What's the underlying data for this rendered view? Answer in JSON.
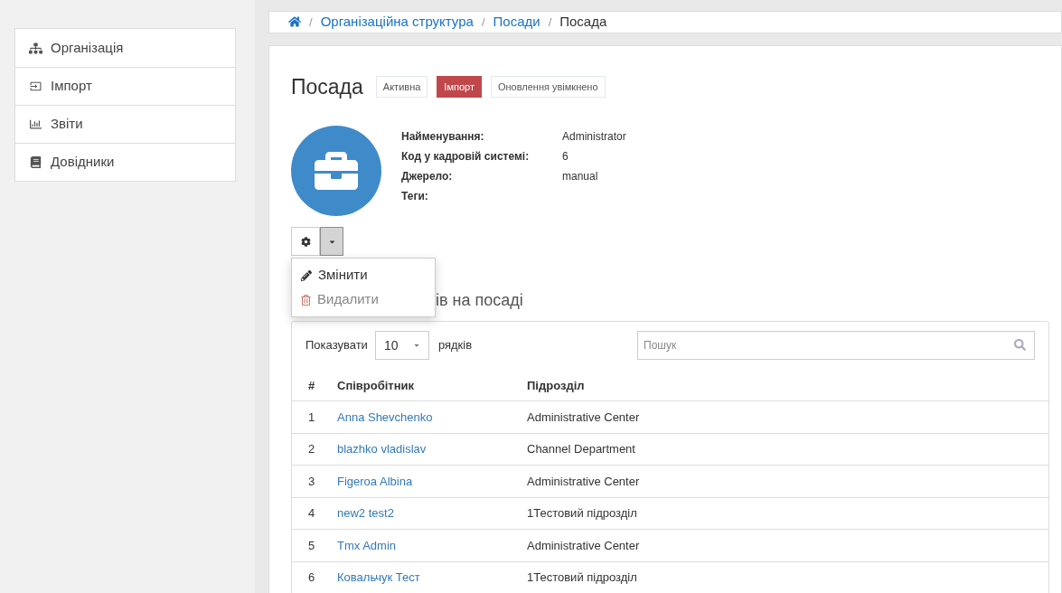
{
  "sidebar": {
    "items": [
      {
        "label": "Організація",
        "kind": "org"
      },
      {
        "label": "Імпорт",
        "kind": "import"
      },
      {
        "label": "Звіти",
        "kind": "reports"
      },
      {
        "label": "Довідники",
        "kind": "book"
      }
    ]
  },
  "breadcrumb": {
    "items": [
      {
        "separator": "/",
        "label": "Організаційна структура",
        "kind": "link"
      },
      {
        "separator": "/",
        "label": "Посади",
        "kind": "link"
      },
      {
        "separator": "/",
        "label": "Посада",
        "kind": "current"
      }
    ]
  },
  "title": "Посада",
  "badges": [
    {
      "label": "Активна",
      "kind": "outline"
    },
    {
      "label": "Імпорт",
      "kind": "danger"
    },
    {
      "label": "Оновлення увімкнено",
      "kind": "outline"
    }
  ],
  "details": [
    {
      "label": "Найменування:",
      "value": "Administrator"
    },
    {
      "label": "Код у кадровій системі:",
      "value": "6"
    },
    {
      "label": "Джерело:",
      "value": "manual"
    },
    {
      "label": "Теги:"
    }
  ],
  "actions_menu": {
    "expanded": true,
    "items": [
      {
        "label": "Змінити",
        "kind": "edit",
        "disabled": false
      },
      {
        "label": "Видалити",
        "kind": "delete",
        "disabled": true
      }
    ]
  },
  "section_heading": "ів на посаді",
  "table_controls": {
    "show_label": "Показувати",
    "page_size": "10",
    "rows_label": "рядків",
    "search": {
      "placeholder": "Пошук"
    }
  },
  "table": {
    "columns": [
      "#",
      "Співробітник",
      "Підрозділ"
    ],
    "rows": [
      {
        "num": "1",
        "employee": "Anna Shevchenko",
        "unit": "Administrative Center"
      },
      {
        "num": "2",
        "employee": "blazhko vladislav",
        "unit": "Channel Department"
      },
      {
        "num": "3",
        "employee": "Figeroa Albina",
        "unit": "Administrative Center"
      },
      {
        "num": "4",
        "employee": "new2 test2",
        "unit": "1Тестовий підрозділ"
      },
      {
        "num": "5",
        "employee": "Tmx Admin",
        "unit": "Administrative Center"
      },
      {
        "num": "6",
        "employee": "Ковальчук Тест",
        "unit": "1Тестовий підрозділ"
      }
    ]
  }
}
